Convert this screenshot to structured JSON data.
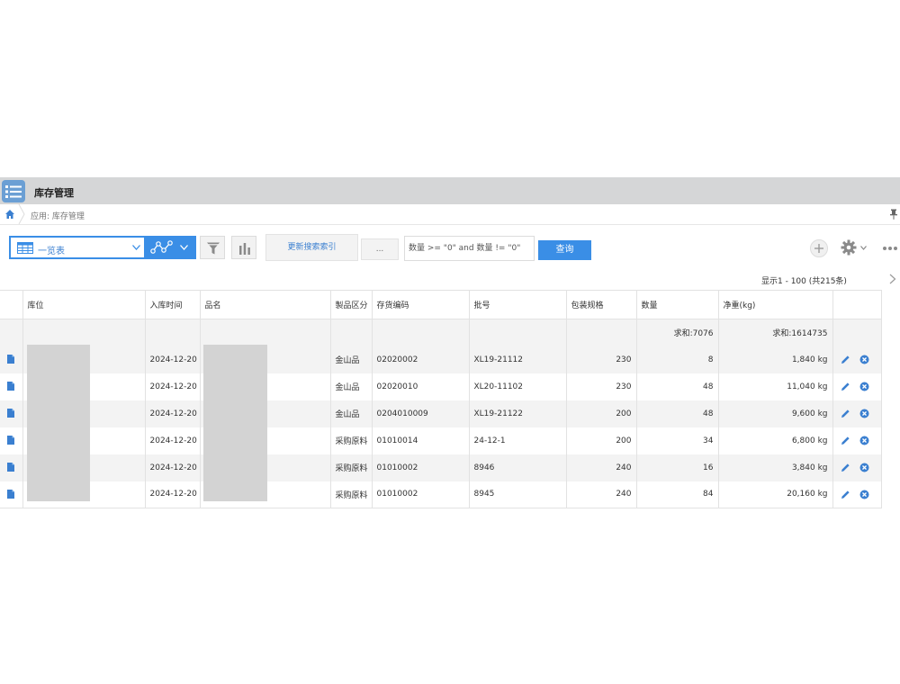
{
  "app": {
    "title": "库存管理"
  },
  "breadcrumb": {
    "text": "应用: 库存管理"
  },
  "toolbar": {
    "view_label": "一览表",
    "reindex_label": "更新搜索索引",
    "dots_label": "...",
    "query_value": "数量 >= \"0\" and 数量 != \"0\"",
    "query_button": "查询"
  },
  "pagination": {
    "text": "显示1 - 100   (共215条)"
  },
  "table": {
    "columns": [
      "库位",
      "入库时间",
      "品名",
      "製品区分",
      "存货编码",
      "批号",
      "包装规格",
      "数量",
      "净重(kg)"
    ],
    "sum_qty": "求和:7076",
    "sum_weight": "求和:1614735",
    "rows": [
      {
        "date": "2024-12-20",
        "category": "金山品",
        "code": "02020002",
        "lot": "XL19-21112",
        "pack": "230",
        "qty": "8",
        "weight": "1,840 kg"
      },
      {
        "date": "2024-12-20",
        "category": "金山品",
        "code": "02020010",
        "lot": "XL20-11102",
        "pack": "230",
        "qty": "48",
        "weight": "11,040 kg"
      },
      {
        "date": "2024-12-20",
        "category": "金山品",
        "code": "0204010009",
        "lot": "XL19-21122",
        "pack": "200",
        "qty": "48",
        "weight": "9,600 kg"
      },
      {
        "date": "2024-12-20",
        "category": "采购原料",
        "code": "01010014",
        "lot": "24-12-1",
        "pack": "200",
        "qty": "34",
        "weight": "6,800 kg"
      },
      {
        "date": "2024-12-20",
        "category": "采购原料",
        "code": "01010002",
        "lot": "8946",
        "pack": "240",
        "qty": "16",
        "weight": "3,840 kg"
      },
      {
        "date": "2024-12-20",
        "category": "采购原料",
        "code": "01010002",
        "lot": "8945",
        "pack": "240",
        "qty": "84",
        "weight": "20,160 kg"
      }
    ]
  },
  "colors": {
    "accent": "#3a8ee6",
    "titlebar": "#d5d6d7",
    "stripe": "#f3f3f3",
    "mask": "#d3d3d3"
  },
  "icons": [
    "list-icon",
    "home-icon",
    "pin-icon",
    "grid-icon",
    "chevron-down-icon",
    "graph-icon",
    "filter-icon",
    "bar-chart-icon",
    "plus-icon",
    "gear-icon",
    "more-icon",
    "chevron-right-icon",
    "document-icon",
    "edit-icon",
    "delete-icon"
  ]
}
